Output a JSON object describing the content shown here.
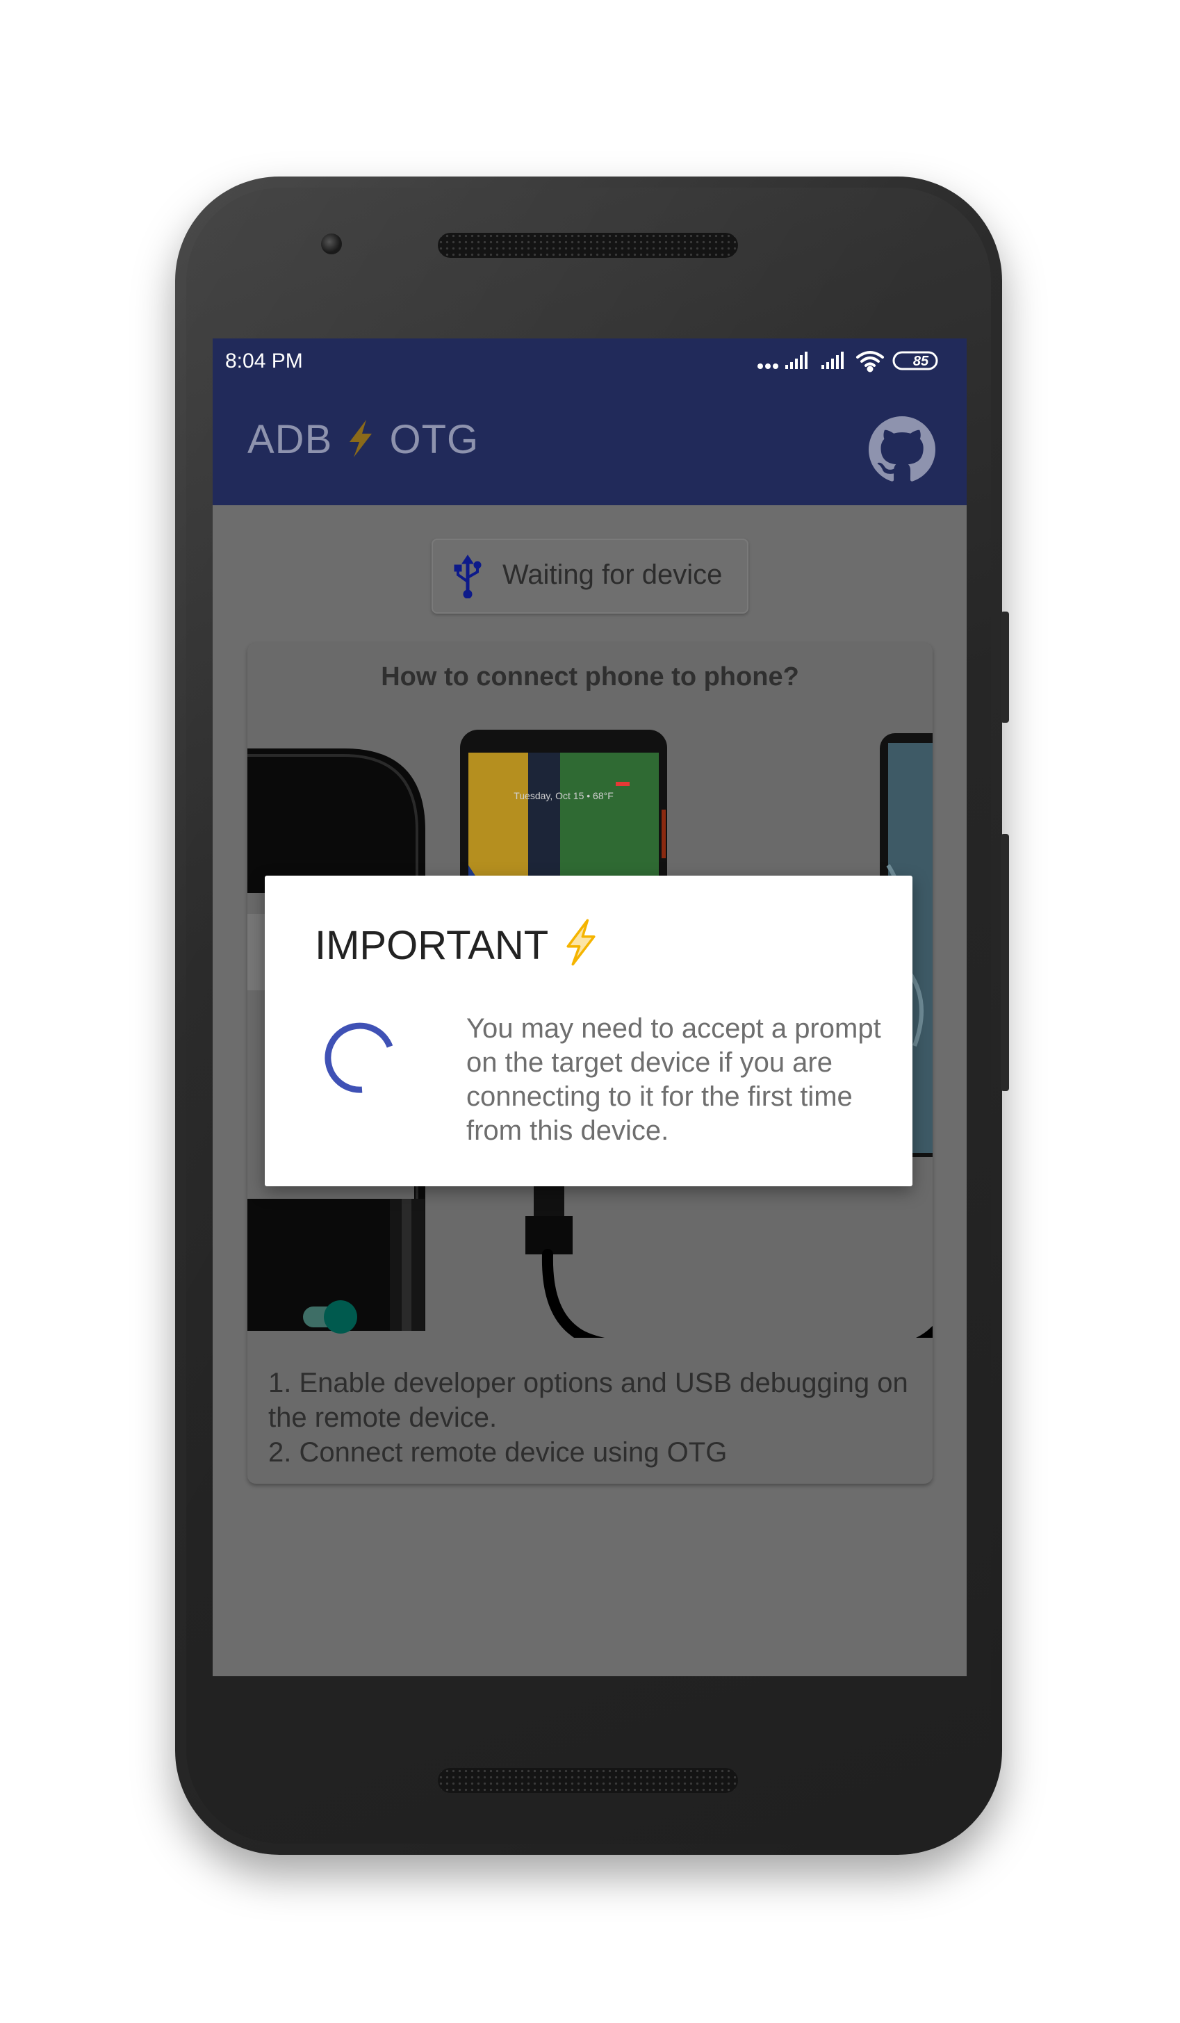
{
  "status_bar": {
    "time": "8:04 PM",
    "battery": "85"
  },
  "toolbar": {
    "title_left": "ADB",
    "title_right": "OTG",
    "github_icon": "github-icon"
  },
  "device_chip": {
    "label": "Waiting for device",
    "icon": "usb-icon"
  },
  "card": {
    "title": "How to connect phone to phone?",
    "steps": [
      "1. Enable developer options and USB debugging on the remote device.",
      "2. Connect remote device using OTG"
    ],
    "phone_clock_text": "Tuesday, Oct 15 • 68°F"
  },
  "dialog": {
    "title": "IMPORTANT",
    "title_icon": "lightning-icon",
    "message": "You may need to accept a prompt on the target device if you are connecting to it for the first time from this device."
  },
  "colors": {
    "app_bar": "#212a5a",
    "accent": "#3f51b5",
    "lightning": "#f5b400",
    "toggle": "#00695c"
  }
}
